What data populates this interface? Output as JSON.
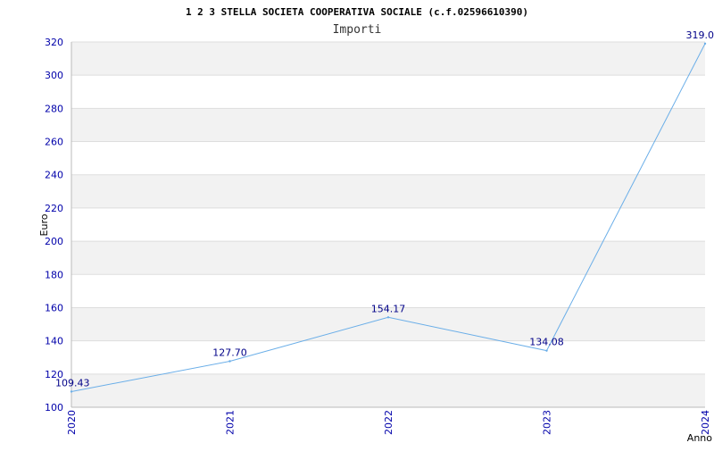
{
  "chart_data": {
    "type": "line",
    "title": "1 2 3 STELLA SOCIETA COOPERATIVA SOCIALE (c.f.02596610390)",
    "subtitle": "Importi",
    "xlabel": "Anno",
    "ylabel": "Euro",
    "categories": [
      "2020",
      "2021",
      "2022",
      "2023",
      "2024"
    ],
    "series": [
      {
        "values": [
          109.43,
          127.7,
          154.17,
          134.08,
          319.0
        ],
        "labels": [
          "109.43",
          "127.70",
          "154.17",
          "134.08",
          "319.0"
        ]
      }
    ],
    "ylim": [
      100,
      320
    ],
    "yticks": [
      "100",
      "120",
      "140",
      "160",
      "180",
      "200",
      "220",
      "240",
      "260",
      "280",
      "300",
      "320"
    ],
    "grid": true,
    "colors": {
      "line": "#6aaee8",
      "band": "#f2f2f2",
      "grid": "#dddddd",
      "tick_text": "#0000aa"
    }
  }
}
